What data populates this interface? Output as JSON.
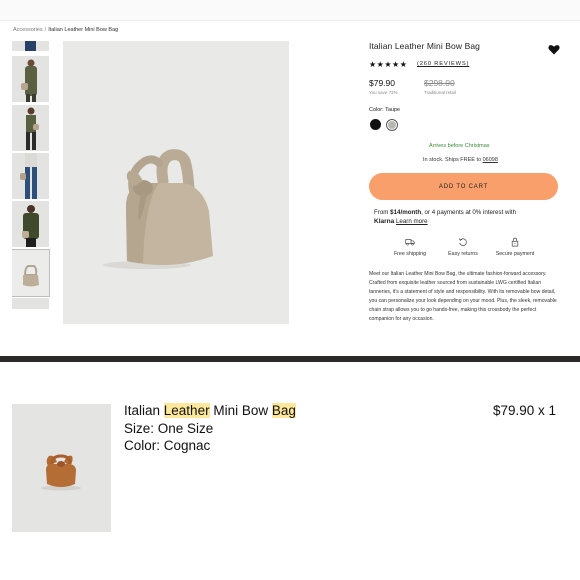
{
  "breadcrumb": {
    "parent": "Accessories",
    "separator": "/",
    "current": "Italian Leather Mini Bow Bag"
  },
  "product": {
    "title": "Italian Leather Mini Bow Bag",
    "stars": "★★★★★",
    "rating": 5,
    "reviews_label": "(260 REVIEWS)",
    "price": "$79.90",
    "saved_label": "You save 72%",
    "original_price": "$298.00",
    "retail_label": "Traditional retail",
    "color_label": "Color: Taupe",
    "swatches": [
      {
        "name": "Black",
        "hex": "#111111"
      },
      {
        "name": "Taupe",
        "hex": "#b8b6b0",
        "selected": true
      }
    ],
    "arrives_label": "Arrives before Christmas",
    "stock_prefix": "In stock. Ships FREE to",
    "zip": "06098",
    "add_to_cart_label": "ADD TO CART",
    "klarna": {
      "line1_prefix": "From ",
      "line1_amount": "$14/month",
      "line1_suffix": ", or 4 payments at 0% interest with",
      "logo": "Klarna",
      "link": "Learn more"
    },
    "perks": [
      {
        "icon": "truck-icon",
        "label": "Free shipping"
      },
      {
        "icon": "return-icon",
        "label": "Easy returns"
      },
      {
        "icon": "lock-icon",
        "label": "Secure payment"
      }
    ],
    "description": "Meet our Italian Leather Mini Bow Bag, the ultimate fashion-forward accessory. Crafted from exquisite leather sourced from sustainable LWG certified Italian tanneries, it's a statement of style and responsibility. With its removable bow detail, you can personalize your look depending on your mood. Plus, the sleek, removable chain strap allows you to go hands-free, making this crossbody the perfect companion for any occasion."
  },
  "cart_item": {
    "name_parts": [
      "Italian ",
      "Leather",
      " Mini Bow ",
      "Bag"
    ],
    "size": "Size: One Size",
    "color": "Color: Cognac",
    "price_qty": "$79.90 x 1"
  },
  "colors": {
    "accent": "#f99f6b",
    "arrives": "#3a8a3a",
    "highlight": "#fde79a",
    "divider": "#2c2a28"
  }
}
